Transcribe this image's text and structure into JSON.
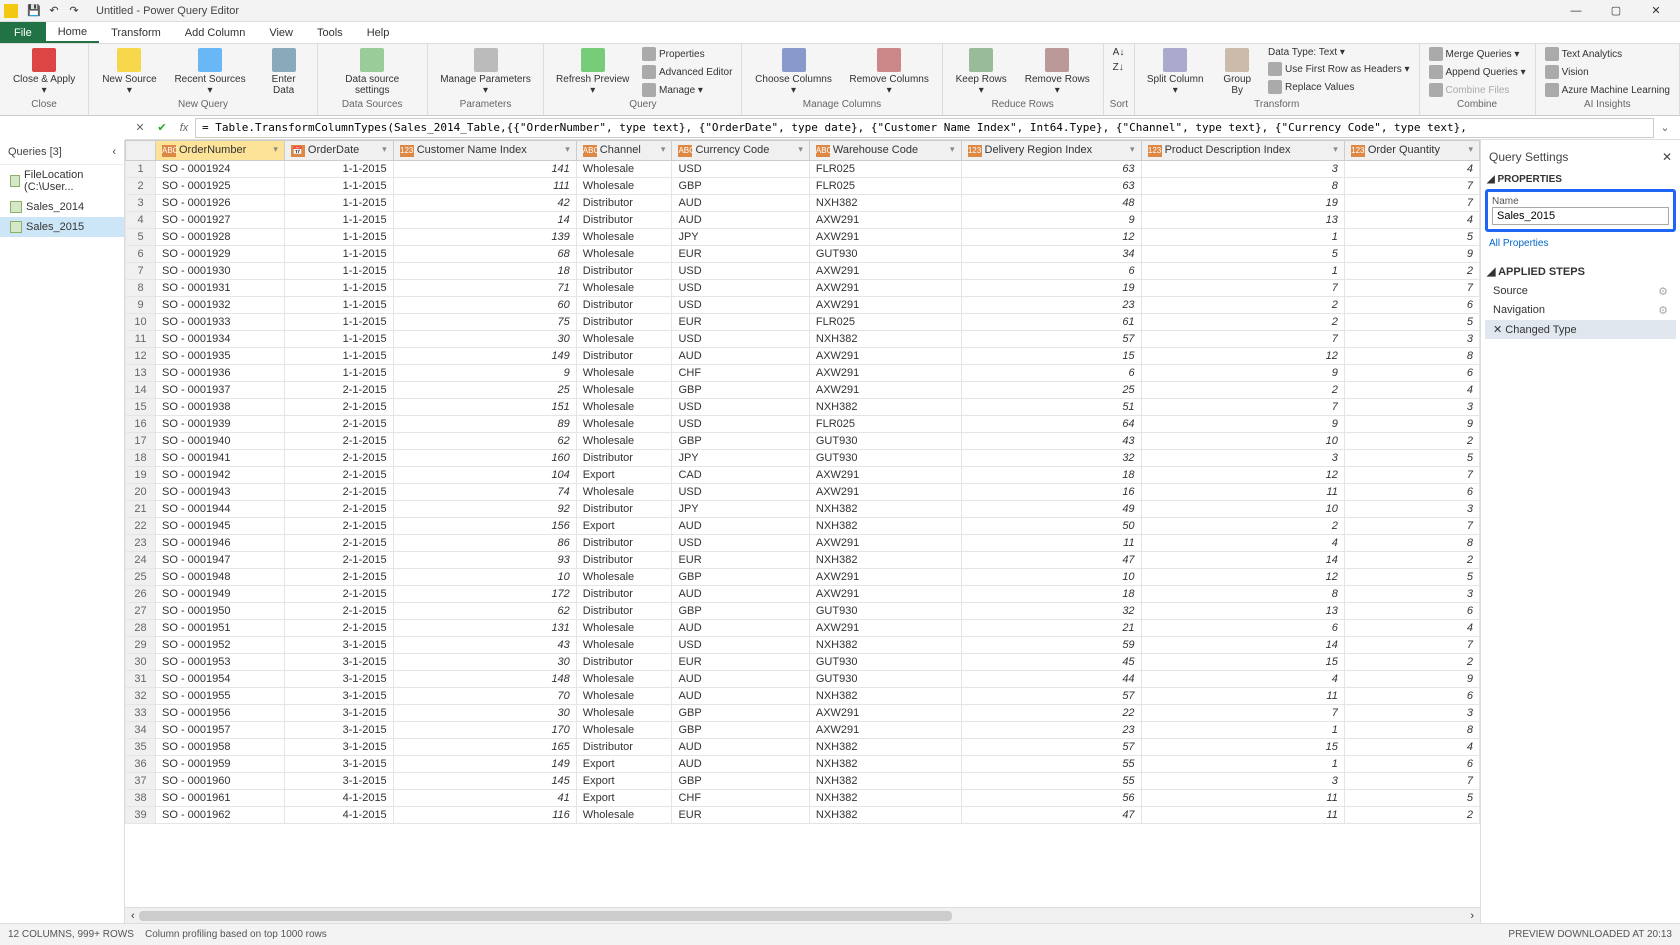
{
  "titlebar": {
    "title": "Untitled - Power Query Editor"
  },
  "menu": {
    "file": "File",
    "tabs": [
      "Home",
      "Transform",
      "Add Column",
      "View",
      "Tools",
      "Help"
    ],
    "active": 0
  },
  "ribbon": {
    "close": {
      "close_apply": "Close &\nApply ▾",
      "group": "Close"
    },
    "new_query": {
      "new_source": "New\nSource ▾",
      "recent": "Recent\nSources ▾",
      "enter": "Enter\nData",
      "group": "New Query"
    },
    "data_sources": {
      "settings": "Data source\nsettings",
      "group": "Data Sources"
    },
    "params": {
      "manage": "Manage\nParameters ▾",
      "group": "Parameters"
    },
    "query": {
      "refresh": "Refresh\nPreview ▾",
      "properties": "Properties",
      "advanced": "Advanced Editor",
      "manage": "Manage ▾",
      "group": "Query"
    },
    "columns": {
      "choose": "Choose\nColumns ▾",
      "remove": "Remove\nColumns ▾",
      "group": "Manage Columns"
    },
    "rows": {
      "keep": "Keep\nRows ▾",
      "remove": "Remove\nRows ▾",
      "group": "Reduce Rows"
    },
    "sort": {
      "group": "Sort"
    },
    "transform": {
      "split": "Split\nColumn ▾",
      "groupby": "Group\nBy",
      "datatype": "Data Type: Text ▾",
      "first_row": "Use First Row as Headers ▾",
      "replace": "Replace Values",
      "group": "Transform"
    },
    "combine": {
      "merge": "Merge Queries ▾",
      "append": "Append Queries ▾",
      "combine_files": "Combine Files",
      "group": "Combine"
    },
    "ai": {
      "text": "Text Analytics",
      "vision": "Vision",
      "azure": "Azure Machine Learning",
      "group": "AI Insights"
    }
  },
  "formula": "= Table.TransformColumnTypes(Sales_2014_Table,{{\"OrderNumber\", type text}, {\"OrderDate\", type date}, {\"Customer Name Index\", Int64.Type}, {\"Channel\", type text}, {\"Currency Code\", type text},",
  "queries": {
    "header": "Queries [3]",
    "items": [
      {
        "label": "FileLocation (C:\\User...",
        "is_param": true
      },
      {
        "label": "Sales_2014",
        "is_param": false
      },
      {
        "label": "Sales_2015",
        "is_param": false
      }
    ],
    "selected": 2
  },
  "columns": [
    {
      "name": "OrderNumber",
      "type": "ABC",
      "selected": true
    },
    {
      "name": "OrderDate",
      "type": "📅"
    },
    {
      "name": "Customer Name Index",
      "type": "123"
    },
    {
      "name": "Channel",
      "type": "ABC"
    },
    {
      "name": "Currency Code",
      "type": "ABC"
    },
    {
      "name": "Warehouse Code",
      "type": "ABC"
    },
    {
      "name": "Delivery Region Index",
      "type": "123"
    },
    {
      "name": "Product Description Index",
      "type": "123"
    },
    {
      "name": "Order Quantity",
      "type": "123"
    }
  ],
  "rows": [
    [
      "SO - 0001924",
      "1-1-2015",
      141,
      "Wholesale",
      "USD",
      "FLR025",
      63,
      3,
      4
    ],
    [
      "SO - 0001925",
      "1-1-2015",
      111,
      "Wholesale",
      "GBP",
      "FLR025",
      63,
      8,
      7
    ],
    [
      "SO - 0001926",
      "1-1-2015",
      42,
      "Distributor",
      "AUD",
      "NXH382",
      48,
      19,
      7
    ],
    [
      "SO - 0001927",
      "1-1-2015",
      14,
      "Distributor",
      "AUD",
      "AXW291",
      9,
      13,
      4
    ],
    [
      "SO - 0001928",
      "1-1-2015",
      139,
      "Wholesale",
      "JPY",
      "AXW291",
      12,
      1,
      5
    ],
    [
      "SO - 0001929",
      "1-1-2015",
      68,
      "Wholesale",
      "EUR",
      "GUT930",
      34,
      5,
      9
    ],
    [
      "SO - 0001930",
      "1-1-2015",
      18,
      "Distributor",
      "USD",
      "AXW291",
      6,
      1,
      2
    ],
    [
      "SO - 0001931",
      "1-1-2015",
      71,
      "Wholesale",
      "USD",
      "AXW291",
      19,
      7,
      7
    ],
    [
      "SO - 0001932",
      "1-1-2015",
      60,
      "Distributor",
      "USD",
      "AXW291",
      23,
      2,
      6
    ],
    [
      "SO - 0001933",
      "1-1-2015",
      75,
      "Distributor",
      "EUR",
      "FLR025",
      61,
      2,
      5
    ],
    [
      "SO - 0001934",
      "1-1-2015",
      30,
      "Wholesale",
      "USD",
      "NXH382",
      57,
      7,
      3
    ],
    [
      "SO - 0001935",
      "1-1-2015",
      149,
      "Distributor",
      "AUD",
      "AXW291",
      15,
      12,
      8
    ],
    [
      "SO - 0001936",
      "1-1-2015",
      9,
      "Wholesale",
      "CHF",
      "AXW291",
      6,
      9,
      6
    ],
    [
      "SO - 0001937",
      "2-1-2015",
      25,
      "Wholesale",
      "GBP",
      "AXW291",
      25,
      2,
      4
    ],
    [
      "SO - 0001938",
      "2-1-2015",
      151,
      "Wholesale",
      "USD",
      "NXH382",
      51,
      7,
      3
    ],
    [
      "SO - 0001939",
      "2-1-2015",
      89,
      "Wholesale",
      "USD",
      "FLR025",
      64,
      9,
      9
    ],
    [
      "SO - 0001940",
      "2-1-2015",
      62,
      "Wholesale",
      "GBP",
      "GUT930",
      43,
      10,
      2
    ],
    [
      "SO - 0001941",
      "2-1-2015",
      160,
      "Distributor",
      "JPY",
      "GUT930",
      32,
      3,
      5
    ],
    [
      "SO - 0001942",
      "2-1-2015",
      104,
      "Export",
      "CAD",
      "AXW291",
      18,
      12,
      7
    ],
    [
      "SO - 0001943",
      "2-1-2015",
      74,
      "Wholesale",
      "USD",
      "AXW291",
      16,
      11,
      6
    ],
    [
      "SO - 0001944",
      "2-1-2015",
      92,
      "Distributor",
      "JPY",
      "NXH382",
      49,
      10,
      3
    ],
    [
      "SO - 0001945",
      "2-1-2015",
      156,
      "Export",
      "AUD",
      "NXH382",
      50,
      2,
      7
    ],
    [
      "SO - 0001946",
      "2-1-2015",
      86,
      "Distributor",
      "USD",
      "AXW291",
      11,
      4,
      8
    ],
    [
      "SO - 0001947",
      "2-1-2015",
      93,
      "Distributor",
      "EUR",
      "NXH382",
      47,
      14,
      2
    ],
    [
      "SO - 0001948",
      "2-1-2015",
      10,
      "Wholesale",
      "GBP",
      "AXW291",
      10,
      12,
      5
    ],
    [
      "SO - 0001949",
      "2-1-2015",
      172,
      "Distributor",
      "AUD",
      "AXW291",
      18,
      8,
      3
    ],
    [
      "SO - 0001950",
      "2-1-2015",
      62,
      "Distributor",
      "GBP",
      "GUT930",
      32,
      13,
      6
    ],
    [
      "SO - 0001951",
      "2-1-2015",
      131,
      "Wholesale",
      "AUD",
      "AXW291",
      21,
      6,
      4
    ],
    [
      "SO - 0001952",
      "3-1-2015",
      43,
      "Wholesale",
      "USD",
      "NXH382",
      59,
      14,
      7
    ],
    [
      "SO - 0001953",
      "3-1-2015",
      30,
      "Distributor",
      "EUR",
      "GUT930",
      45,
      15,
      2
    ],
    [
      "SO - 0001954",
      "3-1-2015",
      148,
      "Wholesale",
      "AUD",
      "GUT930",
      44,
      4,
      9
    ],
    [
      "SO - 0001955",
      "3-1-2015",
      70,
      "Wholesale",
      "AUD",
      "NXH382",
      57,
      11,
      6
    ],
    [
      "SO - 0001956",
      "3-1-2015",
      30,
      "Wholesale",
      "GBP",
      "AXW291",
      22,
      7,
      3
    ],
    [
      "SO - 0001957",
      "3-1-2015",
      170,
      "Wholesale",
      "GBP",
      "AXW291",
      23,
      1,
      8
    ],
    [
      "SO - 0001958",
      "3-1-2015",
      165,
      "Distributor",
      "AUD",
      "NXH382",
      57,
      15,
      4
    ],
    [
      "SO - 0001959",
      "3-1-2015",
      149,
      "Export",
      "AUD",
      "NXH382",
      55,
      1,
      6
    ],
    [
      "SO - 0001960",
      "3-1-2015",
      145,
      "Export",
      "GBP",
      "NXH382",
      55,
      3,
      7
    ],
    [
      "SO - 0001961",
      "4-1-2015",
      41,
      "Export",
      "CHF",
      "NXH382",
      56,
      11,
      5
    ],
    [
      "SO - 0001962",
      "4-1-2015",
      116,
      "Wholesale",
      "EUR",
      "NXH382",
      47,
      11,
      2
    ]
  ],
  "settings": {
    "header": "Query Settings",
    "properties": "PROPERTIES",
    "name_label": "Name",
    "name_value": "Sales_2015",
    "all_props": "All Properties",
    "applied_steps": "APPLIED STEPS",
    "steps": [
      "Source",
      "Navigation",
      "Changed Type"
    ],
    "selected_step": 2
  },
  "status": {
    "left": "12 COLUMNS, 999+ ROWS",
    "mid": "Column profiling based on top 1000 rows",
    "right": "PREVIEW DOWNLOADED AT 20:13"
  }
}
